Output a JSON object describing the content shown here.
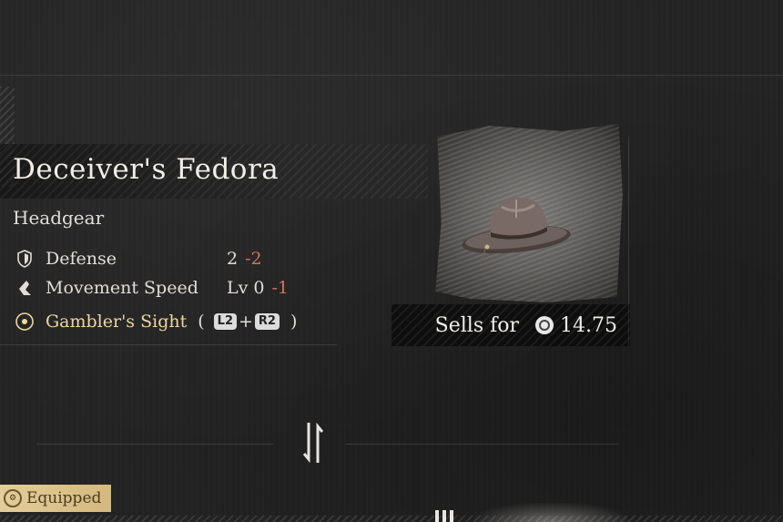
{
  "item": {
    "name": "Deceiver's Fedora",
    "category": "Headgear",
    "stats": [
      {
        "icon": "shield-icon",
        "name": "Defense",
        "value": "2",
        "delta": "-2"
      },
      {
        "icon": "boot-icon",
        "name": "Movement Speed",
        "value": "Lv 0",
        "delta": "-1"
      }
    ],
    "skill": {
      "icon": "eye-icon",
      "name": "Gambler's Sight",
      "paren_open": "(",
      "key1": "L2",
      "plus": "+",
      "key2": "R2",
      "paren_close": ")"
    },
    "image_icon": "fedora-hat-icon"
  },
  "sell": {
    "label": "Sells for",
    "currency_icon": "ergo-coin-icon",
    "price": "14.75"
  },
  "equipped_badge": {
    "icon": "gear-icon",
    "label": "Equipped"
  },
  "colors": {
    "background": "#232323",
    "negative": "#d4705a",
    "skill": "#f0d6a0",
    "equipped": "#dcc38c"
  }
}
